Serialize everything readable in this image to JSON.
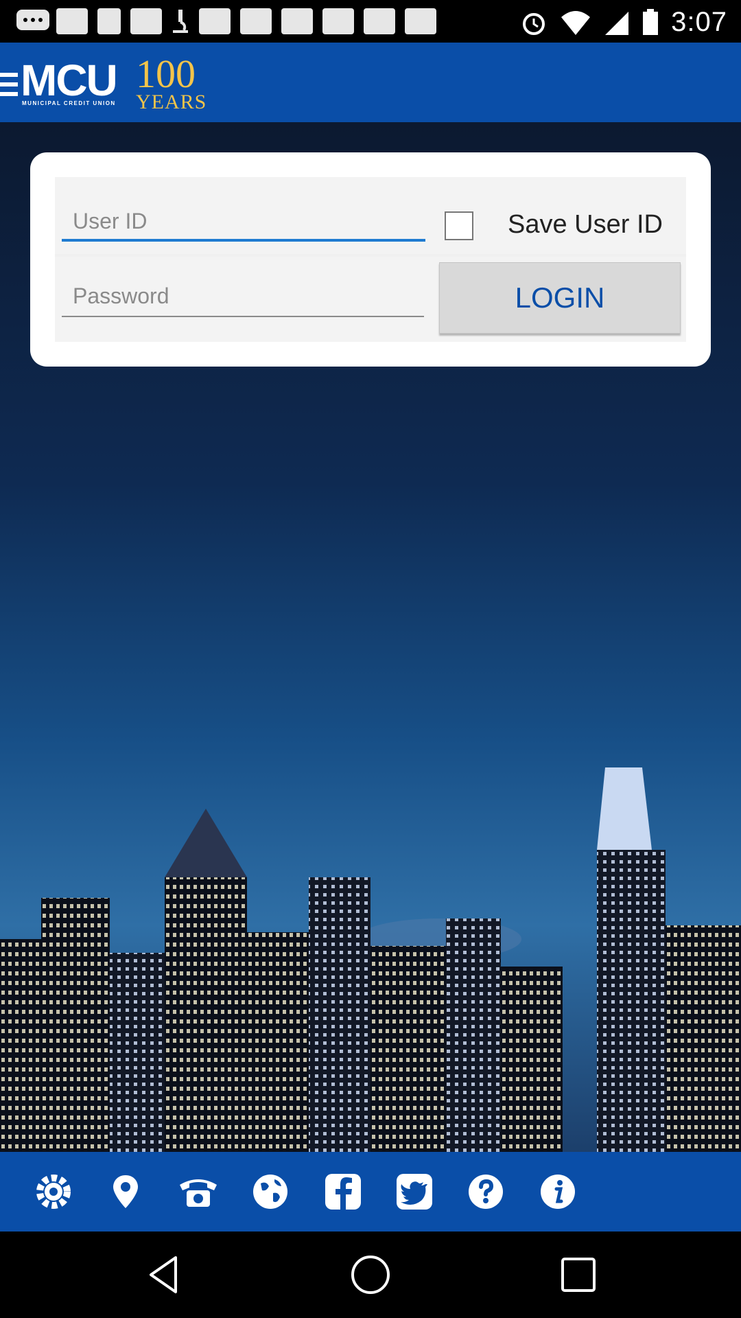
{
  "status_bar": {
    "time": "3:07",
    "icons": [
      "message-icon",
      "image-icon",
      "facebook-icon",
      "image-icon",
      "microscope-icon",
      "image-icon",
      "image-icon",
      "image-icon",
      "image-icon",
      "image-icon",
      "image-icon",
      "alarm-icon",
      "wifi-icon",
      "signal-icon",
      "battery-icon"
    ]
  },
  "header": {
    "logo_text": "MCU",
    "logo_subtext": "MUNICIPAL CREDIT UNION",
    "anniversary_number": "100",
    "anniversary_word": "YEARS"
  },
  "login": {
    "user_id_placeholder": "User ID",
    "password_placeholder": "Password",
    "save_user_id_label": "Save User ID",
    "save_user_id_checked": false,
    "login_button": "LOGIN"
  },
  "toolbar": {
    "icons": [
      "settings-icon",
      "location-pin-icon",
      "telephone-icon",
      "globe-icon",
      "facebook-icon",
      "twitter-icon",
      "help-icon",
      "info-icon"
    ]
  },
  "colors": {
    "brand_blue": "#0a4ea8",
    "accent_gold": "#f3c44a",
    "input_focus": "#1f7bd1"
  }
}
